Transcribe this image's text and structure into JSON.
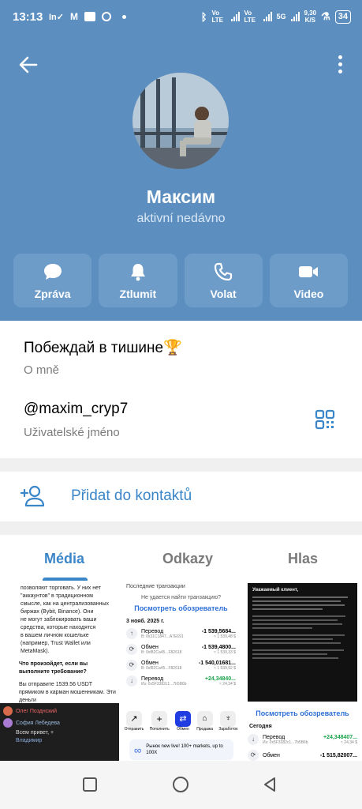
{
  "status_bar": {
    "time": "13:13",
    "speed": "9,30",
    "speed_unit": "K/S",
    "battery": "34",
    "net1": "Vo LTE",
    "net2": "Vo LTE",
    "net3": "5G"
  },
  "profile": {
    "name": "Максим",
    "status": "aktivní nedávno"
  },
  "actions": [
    {
      "label": "Zpráva",
      "icon": "message-icon"
    },
    {
      "label": "Ztlumit",
      "icon": "bell-icon"
    },
    {
      "label": "Volat",
      "icon": "phone-icon"
    },
    {
      "label": "Video",
      "icon": "video-camera-icon"
    }
  ],
  "bio": {
    "text": "Побеждай в тишине🏆",
    "label": "O mně"
  },
  "username": {
    "value": "@maxim_cryp7",
    "label": "Uživatelské jméno"
  },
  "add_contact": {
    "label": "Přidat do kontaktů"
  },
  "tabs": [
    {
      "label": "Média",
      "active": true
    },
    {
      "label": "Odkazy",
      "active": false
    },
    {
      "label": "Hlas",
      "active": false
    }
  ],
  "media": {
    "m1": {
      "lines": [
        "позволяют торговать. У них нет",
        "\"аккаунтов\" в традиционном",
        "смысле, как на централизованных",
        "биржах (Bybit, Binance). Они",
        "не могут заблокировать ваши",
        "средства, которые находятся",
        "в вашем личном кошельке",
        "(например, Trust Wallet или",
        "MetaMask)."
      ],
      "question": "Что произойдет, если вы выполните требование?",
      "after": "Вы отправите 1539.56 USDT прямиком в карман мошенникам. Эти деньги",
      "chat": [
        "Олег Позднский",
        "София Лебедева",
        "Всем привет, +",
        "Владимир"
      ]
    },
    "m2": {
      "top": "Последние транзакции",
      "q": "Не удается найти транзакцию?",
      "link": "Посмотреть обозреватель",
      "date": "3 нояб. 2025 г.",
      "tx": [
        {
          "type": "Перевод",
          "amount": "-1 539,5684...",
          "sub": "В: 0x31C1847...A7E691",
          "usd": "≈ 1 539,48 $"
        },
        {
          "type": "Обмен",
          "amount": "-1 539,4800...",
          "sub": "В: 0xf82Ca45...F82618",
          "usd": "≈ 1 539,33 $"
        },
        {
          "type": "Обмен",
          "amount": "-1 540,01681...",
          "sub": "В: 0xf82Ca45...F82618",
          "usd": "≈ 1 539,92 $"
        },
        {
          "type": "Перевод",
          "amount": "+24,34840...",
          "sub": "Из: 0x5F3382c1...7b5B6b",
          "usd": "≈ 24,34 $"
        }
      ],
      "bottom_buttons": [
        "Отправить",
        "Пополнить",
        "Обмен",
        "Продажа",
        "Заработок"
      ],
      "promo": "Рынок new live! 100+ markets, up to 100X"
    },
    "m3": {
      "title": "Уважаемый клиент,",
      "link": "Посмотреть обозреватель",
      "label": "Сегодня",
      "tx": [
        {
          "type": "Перевод",
          "amount": "+24,348407...",
          "sub": "Из: 0x5F3382c1...7b5B6b",
          "usd": "≈ 24,34 $"
        },
        {
          "type": "Обмен",
          "amount": "-1 515,82007...",
          "sub": "",
          "usd": ""
        }
      ]
    }
  },
  "colors": {
    "header": "#5c8fc0",
    "action_bg": "#6d9cc9",
    "accent": "#3a86c8"
  }
}
